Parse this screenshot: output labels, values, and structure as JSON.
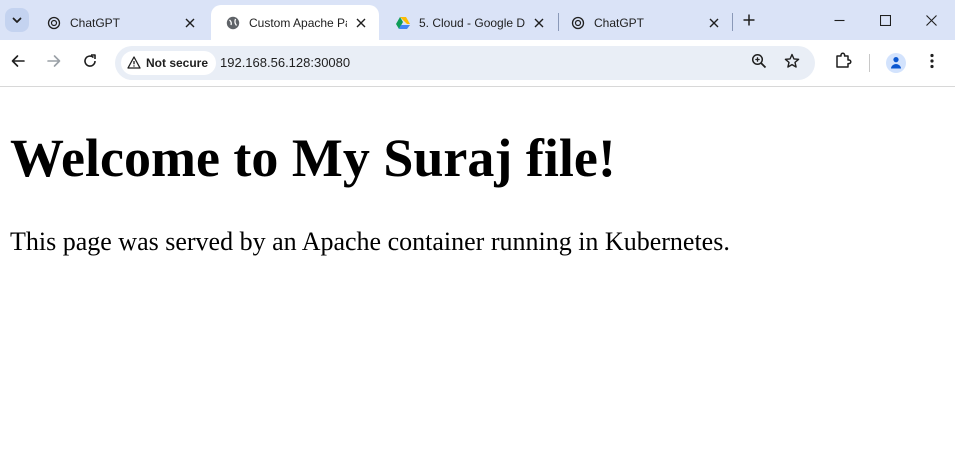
{
  "browser": {
    "tabs": [
      {
        "title": "ChatGPT",
        "icon": "openai-icon",
        "active": false
      },
      {
        "title": "Custom Apache Pag",
        "icon": "globe-icon",
        "active": true
      },
      {
        "title": "5. Cloud - Google D",
        "icon": "google-drive-icon",
        "active": false
      },
      {
        "title": "ChatGPT",
        "icon": "openai-icon",
        "active": false
      }
    ],
    "security_label": "Not secure",
    "url": "192.168.56.128:30080",
    "colors": {
      "tabstrip": "#dae3f7",
      "omnibox": "#e9eef6",
      "accent": "#0b57d0"
    }
  },
  "page": {
    "heading": "Welcome to My Suraj file!",
    "body": "This page was served by an Apache container running in Kubernetes."
  }
}
